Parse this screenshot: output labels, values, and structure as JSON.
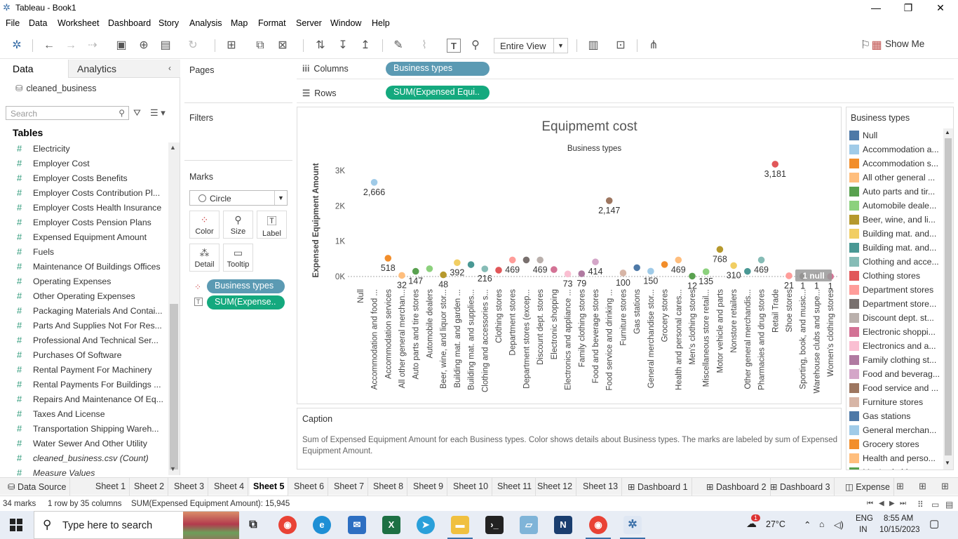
{
  "window": {
    "title": "Tableau - Book1",
    "min_glyph": "—",
    "max_glyph": "❐",
    "close_glyph": "✕"
  },
  "menu": [
    "File",
    "Data",
    "Worksheet",
    "Dashboard",
    "Story",
    "Analysis",
    "Map",
    "Format",
    "Server",
    "Window",
    "Help"
  ],
  "toolbar": {
    "view_mode": "Entire View",
    "show_me": "Show Me"
  },
  "left_pane": {
    "tabs": [
      "Data",
      "Analytics"
    ],
    "datasource": "cleaned_business",
    "search_placeholder": "Search",
    "tables_heading": "Tables",
    "fields": [
      {
        "name": "Electricity",
        "italic": false
      },
      {
        "name": "Employer Cost",
        "italic": false
      },
      {
        "name": "Employer Costs Benefits",
        "italic": false
      },
      {
        "name": "Employer Costs Contribution Pl...",
        "italic": false
      },
      {
        "name": "Employer Costs Health Insurance",
        "italic": false
      },
      {
        "name": "Employer Costs Pension Plans",
        "italic": false
      },
      {
        "name": "Expensed Equipment Amount",
        "italic": false
      },
      {
        "name": "Fuels",
        "italic": false
      },
      {
        "name": "Maintenance Of Buildings Offices",
        "italic": false
      },
      {
        "name": "Operating Expenses",
        "italic": false
      },
      {
        "name": "Other Operating Expenses",
        "italic": false
      },
      {
        "name": "Packaging Materials And Contai...",
        "italic": false
      },
      {
        "name": "Parts And Supplies Not For Res...",
        "italic": false
      },
      {
        "name": "Professional And Technical Ser...",
        "italic": false
      },
      {
        "name": "Purchases Of Software",
        "italic": false
      },
      {
        "name": "Rental Payment For Machinery",
        "italic": false
      },
      {
        "name": "Rental Payments For Buildings ...",
        "italic": false
      },
      {
        "name": "Repairs And Maintenance Of Eq...",
        "italic": false
      },
      {
        "name": "Taxes And License",
        "italic": false
      },
      {
        "name": "Transportation Shipping Wareh...",
        "italic": false
      },
      {
        "name": "Water Sewer And Other Utility",
        "italic": false
      },
      {
        "name": "cleaned_business.csv (Count)",
        "italic": true
      },
      {
        "name": "Measure Values",
        "italic": true
      }
    ]
  },
  "cards": {
    "pages": "Pages",
    "filters": "Filters",
    "marks": "Marks",
    "mark_type": "Circle",
    "mark_buttons": [
      "Color",
      "Size",
      "Label",
      "Detail",
      "Tooltip"
    ],
    "mark_pills": [
      "Business types",
      "SUM(Expense.."
    ]
  },
  "shelves": {
    "columns_label": "Columns",
    "columns_pill": "Business types",
    "rows_label": "Rows",
    "rows_pill": "SUM(Expensed Equi.."
  },
  "chart_data": {
    "type": "scatter",
    "title": "Equipmemt cost",
    "header": "Business types",
    "ylabel": "Expensed Equipment Amount",
    "ylim": [
      0,
      3300
    ],
    "yticks": [
      0,
      1000,
      2000,
      3000
    ],
    "ytick_labels": [
      "0K",
      "1K",
      "2K",
      "3K"
    ],
    "null_indicator": "1 null",
    "categories": [
      "Null",
      "Accommodation and food ...",
      "Accommodation services",
      "All other general merchan...",
      "Auto parts and tire stores",
      "Automobile dealers",
      "Beer, wine, and liquor stor...",
      "Building mat. and garden ...",
      "Building mat. and supplies...",
      "Clothing and accessories s...",
      "Clothing stores",
      "Department stores",
      "Department stores (excep...",
      "Discount dept. stores",
      "Electronic shopping",
      "Electronics and appliance ...",
      "Family clothing stores",
      "Food and beverage stores",
      "Food service and drinking ...",
      "Furniture stores",
      "Gas stations",
      "General merchandise stor...",
      "Grocery stores",
      "Health and personal cares...",
      "Men's clothing stores",
      "Miscellaneous store retail...",
      "Motor vehicle and parts",
      "Nonstore retailers",
      "Other general merchandis...",
      "Pharmacies and drug stores",
      "Retail Trade",
      "Shoe stores",
      "Sporting, book, and music...",
      "Warehouse clubs and supe...",
      "Women's clothing stores"
    ],
    "values": [
      null,
      2666,
      518,
      32,
      147,
      221,
      48,
      392,
      337,
      216,
      180,
      469,
      469,
      469,
      197,
      73,
      79,
      414,
      2147,
      100,
      250,
      150,
      340,
      469,
      12,
      135,
      768,
      310,
      146,
      469,
      3181,
      21,
      8,
      11,
      1
    ],
    "value_labels": [
      "",
      "2,666",
      "518",
      "32",
      "147",
      "",
      "48",
      "392",
      "",
      "216",
      "",
      "469",
      "",
      "469",
      "",
      "73",
      "79",
      "414",
      "2,147",
      "100",
      "",
      "150",
      "",
      "469",
      "12",
      "135",
      "768",
      "310",
      "",
      "469",
      "3,181",
      "21",
      "1",
      "1",
      "1"
    ],
    "colors": [
      "#4e79a7",
      "#a0cbe8",
      "#f28e2b",
      "#ffbe7d",
      "#59a14f",
      "#8cd17d",
      "#b6992d",
      "#f1ce63",
      "#499894",
      "#86bcb6",
      "#e15759",
      "#ff9d9a",
      "#79706e",
      "#bab0ac",
      "#d37295",
      "#fabfd2",
      "#b07aa1",
      "#d4a6c8",
      "#9d7660",
      "#d7b5a6",
      "#4e79a7",
      "#a0cbe8",
      "#f28e2b",
      "#ffbe7d",
      "#59a14f",
      "#8cd17d",
      "#b6992d",
      "#f1ce63",
      "#499894",
      "#86bcb6",
      "#e15759",
      "#ff9d9a",
      "#79706e",
      "#bab0ac",
      "#d37295"
    ]
  },
  "caption": {
    "heading": "Caption",
    "text": "Sum of Expensed Equipment Amount for each Business types.  Color shows details about Business types.  The marks are labeled by sum of Expensed Equipment Amount."
  },
  "legend": {
    "title": "Business types",
    "items": [
      {
        "name": "Null",
        "color": "#4e79a7"
      },
      {
        "name": "Accommodation a...",
        "color": "#a0cbe8"
      },
      {
        "name": "Accommodation s...",
        "color": "#f28e2b"
      },
      {
        "name": "All other general ...",
        "color": "#ffbe7d"
      },
      {
        "name": "Auto parts and tir...",
        "color": "#59a14f"
      },
      {
        "name": "Automobile deale...",
        "color": "#8cd17d"
      },
      {
        "name": "Beer, wine, and li...",
        "color": "#b6992d"
      },
      {
        "name": "Building mat. and...",
        "color": "#f1ce63"
      },
      {
        "name": "Building mat. and...",
        "color": "#499894"
      },
      {
        "name": "Clothing and acce...",
        "color": "#86bcb6"
      },
      {
        "name": "Clothing stores",
        "color": "#e15759"
      },
      {
        "name": "Department stores",
        "color": "#ff9d9a"
      },
      {
        "name": "Department store...",
        "color": "#79706e"
      },
      {
        "name": "Discount dept. st...",
        "color": "#bab0ac"
      },
      {
        "name": "Electronic shoppi...",
        "color": "#d37295"
      },
      {
        "name": "Electronics and a...",
        "color": "#fabfd2"
      },
      {
        "name": "Family clothing st...",
        "color": "#b07aa1"
      },
      {
        "name": "Food and beverag...",
        "color": "#d4a6c8"
      },
      {
        "name": "Food service and ...",
        "color": "#9d7660"
      },
      {
        "name": "Furniture stores",
        "color": "#d7b5a6"
      },
      {
        "name": "Gas stations",
        "color": "#4e79a7"
      },
      {
        "name": "General merchan...",
        "color": "#a0cbe8"
      },
      {
        "name": "Grocery stores",
        "color": "#f28e2b"
      },
      {
        "name": "Health and perso...",
        "color": "#ffbe7d"
      },
      {
        "name": "Men's clothing st...",
        "color": "#59a14f"
      }
    ]
  },
  "sheet_tabs": [
    "Data Source",
    "Sheet 1",
    "Sheet 2",
    "Sheet 3",
    "Sheet 4",
    "Sheet 5",
    "Sheet 6",
    "Sheet 7",
    "Sheet 8",
    "Sheet 9",
    "Sheet 10",
    "Sheet 11",
    "Sheet 12",
    "Sheet 13",
    "Dashboard 1",
    "Dashboard 2",
    "Dashboard 3",
    "Expense"
  ],
  "active_sheet": "Sheet 5",
  "status": {
    "marks": "34 marks",
    "dims": "1 row by 35 columns",
    "sum": "SUM(Expensed Equipment Amount): 15,945"
  },
  "taskbar": {
    "search_placeholder": "Type here to search",
    "weather": "27°C",
    "notification_count": "1",
    "lang": "ENG",
    "region": "IN",
    "time": "8:55 AM",
    "date": "10/15/2023"
  }
}
